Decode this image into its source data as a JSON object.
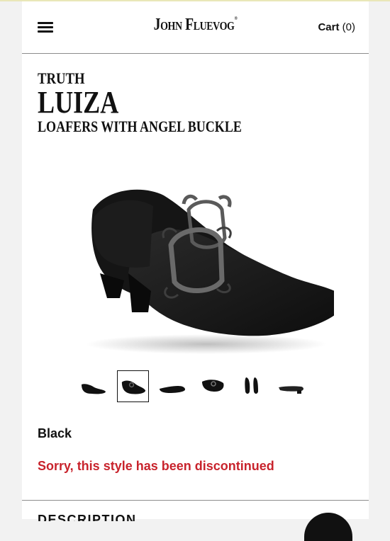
{
  "header": {
    "menu_icon": "hamburger-icon",
    "logo_text": "John Fluevog",
    "cart_label": "Cart",
    "cart_count": "(0)"
  },
  "product": {
    "collection": "TRUTH",
    "name": "LUIZA",
    "subtitle": "LOAFERS WITH ANGEL BUCKLE",
    "color": "Black",
    "status": "Sorry, this style has been discontinued",
    "thumbnails_selected_index": 1,
    "thumbnail_count": 6
  },
  "sections": {
    "description_heading": "DESCRIPTION"
  },
  "colors": {
    "discontinued_red": "#c8232c",
    "text": "#111111"
  }
}
